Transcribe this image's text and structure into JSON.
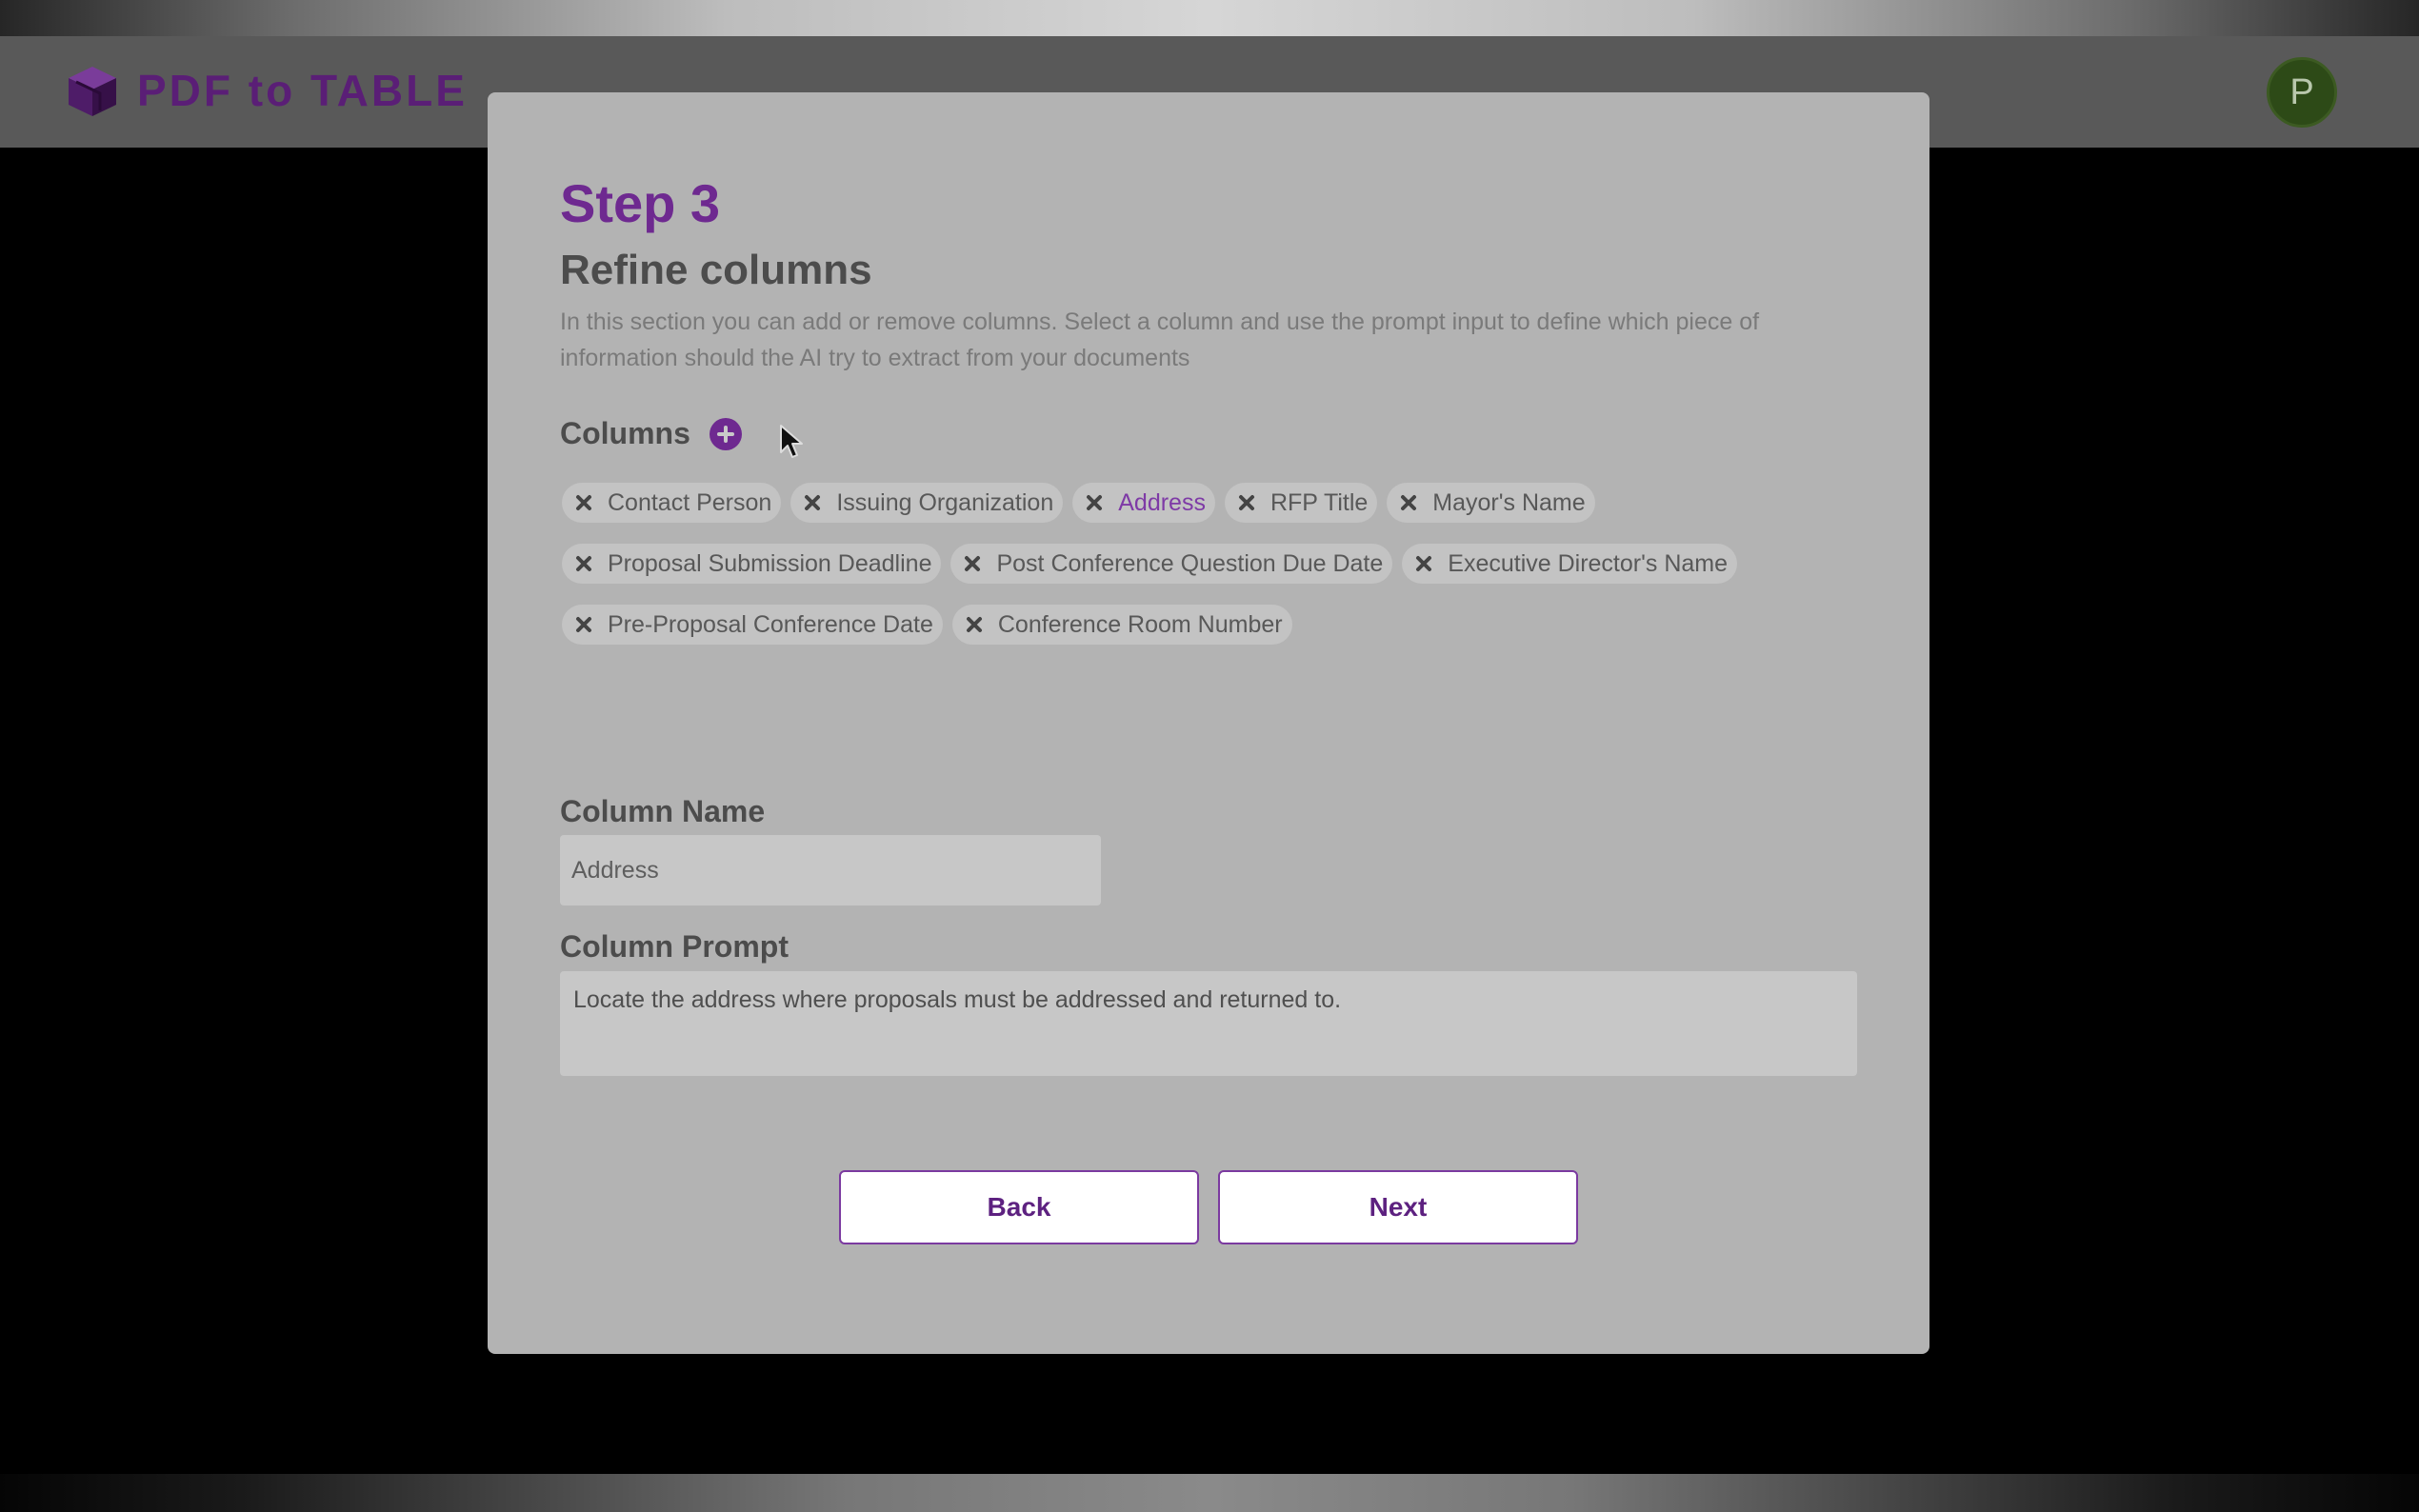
{
  "app": {
    "name": "PDF to TABLE",
    "avatar_initial": "P"
  },
  "wizard": {
    "step_title": "Step 3",
    "section_title": "Refine columns",
    "description": "In this section you can add or remove columns.  Select a column and use the prompt input to define which piece of information should the AI try to extract from your documents",
    "columns_label": "Columns",
    "columns": [
      {
        "label": "Contact Person",
        "selected": false
      },
      {
        "label": "Issuing Organization",
        "selected": false
      },
      {
        "label": "Address",
        "selected": true
      },
      {
        "label": "RFP Title",
        "selected": false
      },
      {
        "label": "Mayor's Name",
        "selected": false
      },
      {
        "label": "Proposal Submission Deadline",
        "selected": false
      },
      {
        "label": "Post Conference Question Due Date",
        "selected": false
      },
      {
        "label": "Executive Director's Name",
        "selected": false
      },
      {
        "label": "Pre-Proposal Conference Date",
        "selected": false
      },
      {
        "label": "Conference Room Number",
        "selected": false
      }
    ],
    "column_name_label": "Column Name",
    "column_name_value": "Address",
    "column_prompt_label": "Column Prompt",
    "column_prompt_value": "Locate the address where proposals must be addressed and returned to.",
    "back_label": "Back",
    "next_label": "Next"
  },
  "colors": {
    "accent": "#6e2990",
    "modal_background": "#b3b3b3",
    "header_background": "#595959"
  }
}
